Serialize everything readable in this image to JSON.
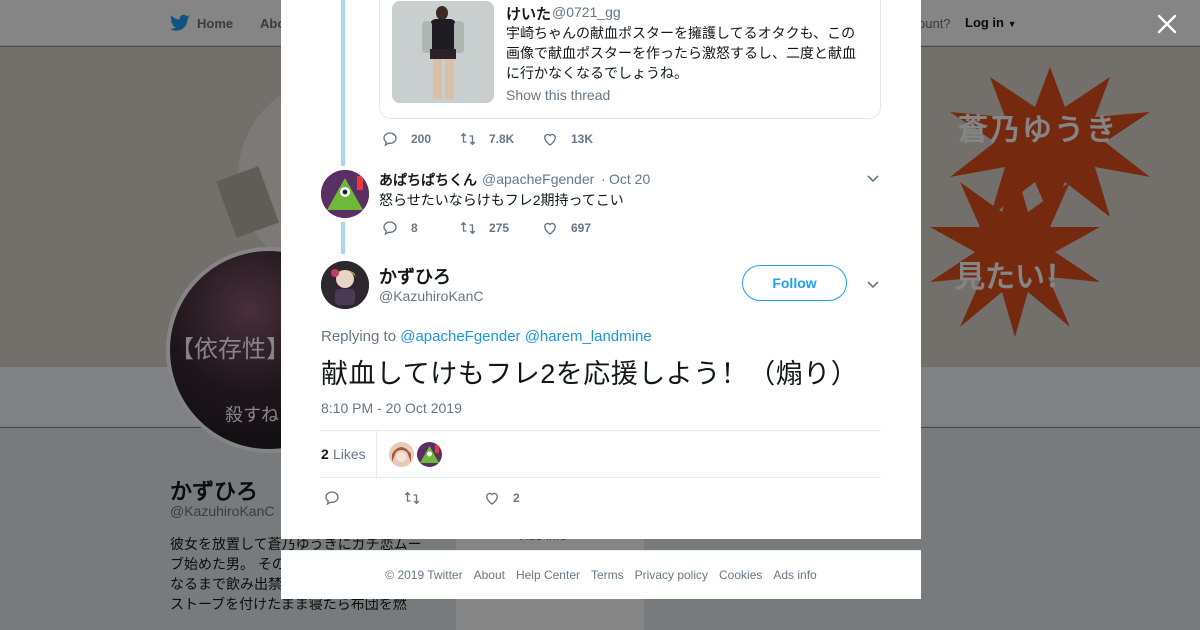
{
  "background": {
    "nav": {
      "home": "Home",
      "about": "Abo",
      "account": "ccount?",
      "login": "Log in"
    },
    "banner": {
      "text1": "蒼乃ゆうき",
      "text2": "見たい！"
    },
    "avatar": {
      "text1": "【依存性】…",
      "text2": "殺すね"
    },
    "profile": {
      "name": "かずひろ",
      "handle": "@KazuhiroKanC",
      "bio": "彼女を放置して蒼乃ゆうきにガチ恋ムーブ始めた男。 その ←New その日知っ くなるまで飲み出禁になった男。 寒いのでストーブを付けたまま寝たら布団を燃",
      "more": "Ads info"
    }
  },
  "quoted": {
    "name": "けいた",
    "handle": "@0721_gg",
    "text": "宇崎ちゃんの献血ポスターを擁護してるオタクも、この画像で献血ポスターを作ったら激怒するし、二度と献血に行かなくなるでしょうね。",
    "show_thread": "Show this thread"
  },
  "quoted_actions": {
    "replies": "200",
    "retweets": "7.8K",
    "likes": "13K"
  },
  "reply": {
    "name": "あぱちぱちくん",
    "handle": "@apacheFgender",
    "dot": "·",
    "date": "Oct 20",
    "text": "怒らせたいならけもフレ2期持ってこい"
  },
  "reply_actions": {
    "replies": "8",
    "retweets": "275",
    "likes": "697"
  },
  "tweet": {
    "name": "かずひろ",
    "handle": "@KazuhiroKanC",
    "follow": "Follow",
    "replying_label": "Replying to",
    "replying_to_1": "@apacheFgender",
    "replying_to_2": "@harem_landmine",
    "text": "献血してけもフレ2を応援しよう！（煽り）",
    "time": "8:10 PM - 20 Oct 2019",
    "likes_count": "2",
    "likes_label": "Likes"
  },
  "tweet_actions": {
    "likes": "2"
  },
  "footer": {
    "copyright": "© 2019 Twitter",
    "about": "About",
    "help": "Help Center",
    "terms": "Terms",
    "privacy": "Privacy policy",
    "cookies": "Cookies",
    "ads": "Ads info"
  },
  "colors": {
    "accent": "#1da1f2",
    "link": "#1b95e0",
    "thread_line": "#a6d8f6",
    "muted": "#657786"
  }
}
